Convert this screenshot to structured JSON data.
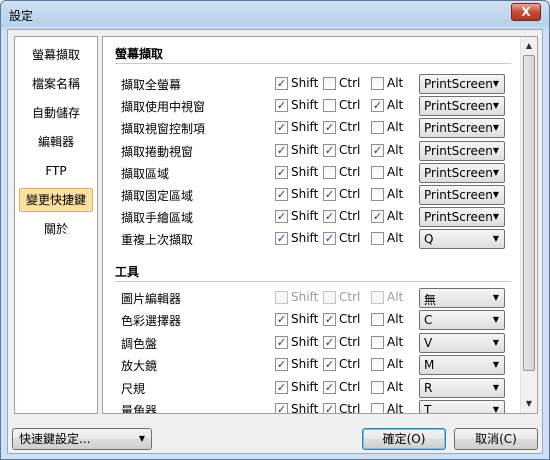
{
  "window": {
    "title": "設定",
    "close_label": "X"
  },
  "sidebar": {
    "items": [
      {
        "label": "螢幕擷取",
        "name": "sidebar-item-screen-capture"
      },
      {
        "label": "檔案名稱",
        "name": "sidebar-item-file-name"
      },
      {
        "label": "自動儲存",
        "name": "sidebar-item-auto-save"
      },
      {
        "label": "編輯器",
        "name": "sidebar-item-editor"
      },
      {
        "label": "FTP",
        "name": "sidebar-item-ftp"
      },
      {
        "label": "變更快捷鍵",
        "name": "sidebar-item-change-hotkeys",
        "active": true
      },
      {
        "label": "關於",
        "name": "sidebar-item-about"
      }
    ]
  },
  "sections": [
    {
      "title": "螢幕擷取",
      "rows": [
        {
          "label": "擷取全螢幕",
          "shift": true,
          "ctrl": false,
          "alt": false,
          "key": "PrintScreen"
        },
        {
          "label": "擷取使用中視窗",
          "shift": true,
          "ctrl": false,
          "alt": true,
          "key": "PrintScreen"
        },
        {
          "label": "擷取視窗控制項",
          "shift": true,
          "ctrl": true,
          "alt": false,
          "key": "PrintScreen"
        },
        {
          "label": "擷取捲動視窗",
          "shift": true,
          "ctrl": true,
          "alt": true,
          "key": "PrintScreen"
        },
        {
          "label": "擷取區域",
          "shift": true,
          "ctrl": false,
          "alt": false,
          "key": "PrintScreen"
        },
        {
          "label": "擷取固定區域",
          "shift": true,
          "ctrl": true,
          "alt": false,
          "key": "PrintScreen"
        },
        {
          "label": "擷取手繪區域",
          "shift": true,
          "ctrl": true,
          "alt": true,
          "key": "PrintScreen"
        },
        {
          "label": "重複上次擷取",
          "shift": true,
          "ctrl": true,
          "alt": false,
          "key": "Q"
        }
      ]
    },
    {
      "title": "工具",
      "rows": [
        {
          "label": "圖片編輯器",
          "shift": false,
          "ctrl": false,
          "alt": false,
          "key": "無",
          "disabled": true
        },
        {
          "label": "色彩選擇器",
          "shift": true,
          "ctrl": true,
          "alt": false,
          "key": "C"
        },
        {
          "label": "調色盤",
          "shift": true,
          "ctrl": true,
          "alt": false,
          "key": "V"
        },
        {
          "label": "放大鏡",
          "shift": true,
          "ctrl": true,
          "alt": false,
          "key": "M"
        },
        {
          "label": "尺規",
          "shift": true,
          "ctrl": true,
          "alt": false,
          "key": "R"
        },
        {
          "label": "量角器",
          "shift": true,
          "ctrl": true,
          "alt": false,
          "key": "T"
        }
      ]
    }
  ],
  "modifiers": {
    "shift": "Shift",
    "ctrl": "Ctrl",
    "alt": "Alt"
  },
  "footer": {
    "hotkey_settings": "快速鍵設定...",
    "ok": "確定(O)",
    "cancel": "取消(C)"
  },
  "icons": {
    "check": "check-icon",
    "dropdown": "chevron-down-icon",
    "scroll_up": "arrow-up-icon",
    "scroll_down": "arrow-down-icon"
  },
  "colors": {
    "active_item_bg": "#fbe0a2",
    "close_button": "#c94a33",
    "check_mark": "#1f3e7a"
  }
}
